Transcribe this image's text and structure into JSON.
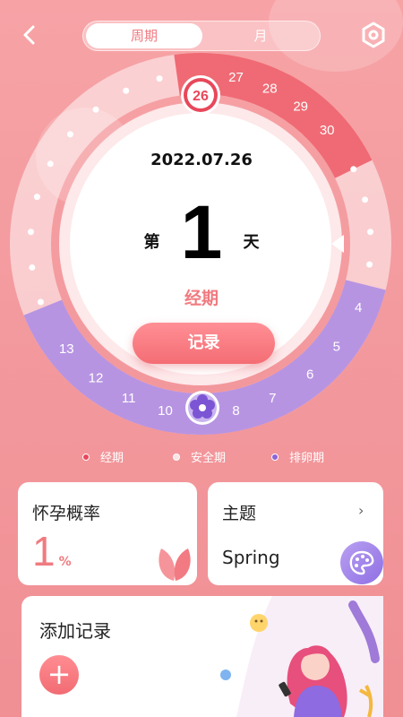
{
  "header": {
    "back_icon": "chevron-left-icon",
    "tabs": [
      {
        "label": "周期",
        "active": true
      },
      {
        "label": "月",
        "active": false
      }
    ],
    "settings_icon": "settings-hexagon-icon"
  },
  "cycle": {
    "date": "2022.07.26",
    "day_prefix": "第",
    "day_number": "1",
    "day_suffix": "天",
    "phase": "经期",
    "record_label": "记录",
    "today_label": "26",
    "period_days": [
      "27",
      "28",
      "29",
      "30"
    ],
    "ovulation_days": [
      "4",
      "5",
      "6",
      "7",
      "8",
      "10",
      "11",
      "12",
      "13"
    ],
    "ovulation_marker_icon": "flower-icon"
  },
  "legend": [
    {
      "label": "经期",
      "color": "#e8485a"
    },
    {
      "label": "安全期",
      "color": "#fbe3e5"
    },
    {
      "label": "排卵期",
      "color": "#8d64d6"
    }
  ],
  "cards": {
    "pregnancy": {
      "title": "怀孕概率",
      "value": "1",
      "unit": "%",
      "icon": "leaf-icon"
    },
    "theme": {
      "title": "主题",
      "arrow": "›",
      "value": "Spring",
      "icon": "palette-icon"
    },
    "add_record": {
      "title": "添加记录",
      "add_label": "+",
      "illustration": "girl-with-phone-illustration"
    }
  },
  "colors": {
    "accent": "#f07b80",
    "period": "#ee6570",
    "ovulation": "#b592e1"
  }
}
